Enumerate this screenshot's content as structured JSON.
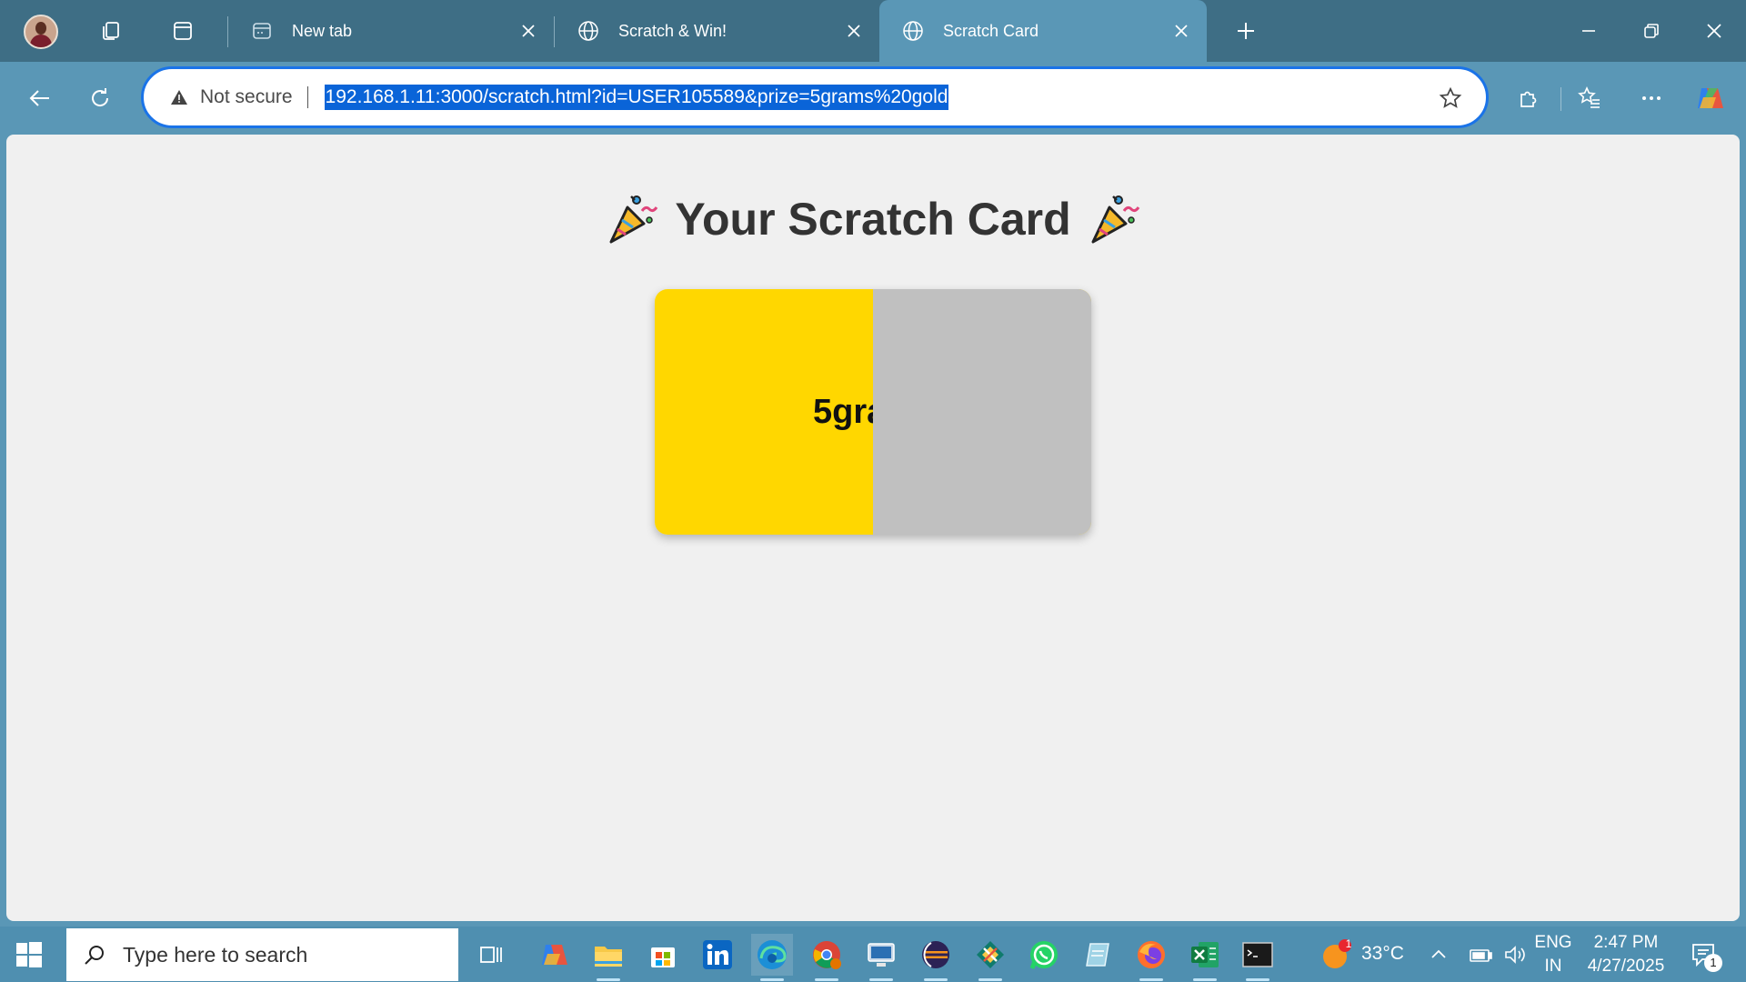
{
  "tabs": [
    {
      "title": "New tab",
      "icon": "new-tab-page-icon"
    },
    {
      "title": "Scratch & Win!",
      "icon": "globe-icon"
    },
    {
      "title": "Scratch Card",
      "icon": "globe-icon",
      "active": true
    }
  ],
  "address_bar": {
    "security_label": "Not secure",
    "url": "192.168.1.11:3000/scratch.html?id=USER105589&prize=5grams%20gold"
  },
  "page": {
    "heading": "Your Scratch Card",
    "heading_emoji": "party-popper-icon",
    "prize_visible_text": "5gram",
    "card_color": "#ffd700",
    "scratch_cover_color": "#c0c0c0",
    "scratched_fraction": 0.5
  },
  "taskbar": {
    "search_placeholder": "Type here to search",
    "weather": {
      "temperature": "33°C",
      "badge": "1"
    },
    "language": {
      "line1": "ENG",
      "line2": "IN"
    },
    "clock": {
      "time": "2:47 PM",
      "date": "4/27/2025"
    },
    "notifications_count": "1"
  },
  "colors": {
    "tabstrip": "#3e6e85",
    "toolbar": "#5a97b6",
    "accent": "#1a73e8"
  }
}
